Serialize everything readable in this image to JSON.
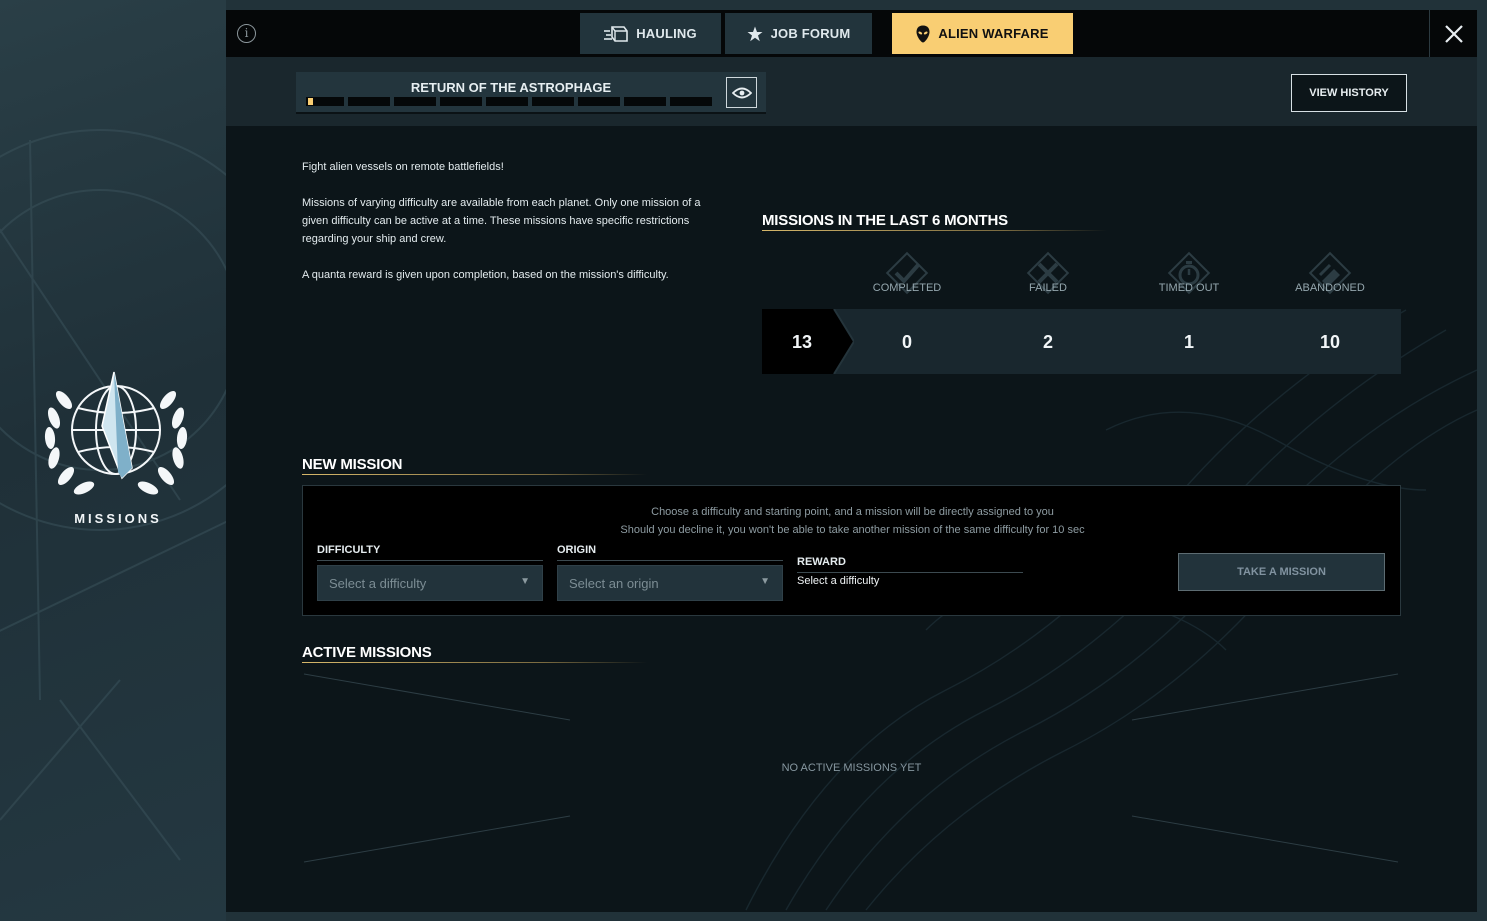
{
  "brand": {
    "label": "MISSIONS"
  },
  "tabs": [
    {
      "label": "HAULING",
      "icon": "cargo-icon"
    },
    {
      "label": "JOB FORUM",
      "icon": "star-icon"
    },
    {
      "label": "ALIEN WARFARE",
      "icon": "alien-head-icon",
      "active": true
    }
  ],
  "progress": {
    "title": "RETURN OF THE ASTROPHAGE",
    "segments_total": 9,
    "fill_fraction": 0.02
  },
  "view_history_label": "VIEW HISTORY",
  "intro": {
    "line1": "Fight alien vessels on remote battlefields!",
    "line2": "Missions of varying difficulty are available from each planet. Only one mission of a given difficulty can be active at a time. These missions have specific restrictions regarding your ship and crew.",
    "line3": "A quanta reward is given upon completion, based on the mission's difficulty."
  },
  "stats": {
    "title": "MISSIONS IN THE LAST 6 MONTHS",
    "total": "13",
    "items": [
      {
        "label": "COMPLETED",
        "value": "0",
        "icon": "checkmark-icon"
      },
      {
        "label": "FAILED",
        "value": "2",
        "icon": "cross-icon"
      },
      {
        "label": "TIMED OUT",
        "value": "1",
        "icon": "stopwatch-icon"
      },
      {
        "label": "ABANDONED",
        "value": "10",
        "icon": "flag-icon"
      }
    ]
  },
  "new_mission": {
    "title": "NEW MISSION",
    "hint1": "Choose a difficulty and starting point, and a mission will be directly assigned to you",
    "hint2": "Should you decline it, you won't be able to take another mission of the same difficulty for 10 sec",
    "difficulty_label": "DIFFICULTY",
    "difficulty_placeholder": "Select a difficulty",
    "origin_label": "ORIGIN",
    "origin_placeholder": "Select an origin",
    "reward_label": "REWARD",
    "reward_value": "Select a difficulty",
    "take_button": "TAKE A MISSION"
  },
  "active_missions": {
    "title": "ACTIVE MISSIONS",
    "empty_text": "NO ACTIVE MISSIONS YET"
  },
  "colors": {
    "accent": "#f9ce73",
    "panel_bg": "#0c1519",
    "tab_bg": "#22343c"
  }
}
